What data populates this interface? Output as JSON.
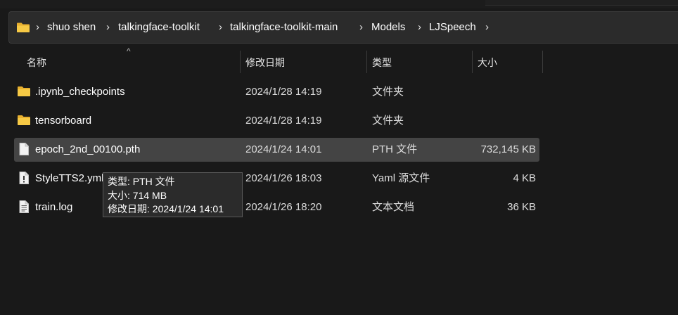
{
  "breadcrumb": {
    "items": [
      "shuo shen",
      "talkingface-toolkit",
      "talkingface-toolkit-main",
      "Models",
      "LJSpeech"
    ],
    "separator": "›"
  },
  "columns": {
    "name": "名称",
    "date": "修改日期",
    "type": "类型",
    "size": "大小",
    "sort_indicator": "^"
  },
  "files": [
    {
      "name": ".ipynb_checkpoints",
      "date": "2024/1/28 14:19",
      "type": "文件夹",
      "size": "",
      "icon": "folder-icon"
    },
    {
      "name": "tensorboard",
      "date": "2024/1/28 14:19",
      "type": "文件夹",
      "size": "",
      "icon": "folder-icon"
    },
    {
      "name": "epoch_2nd_00100.pth",
      "date": "2024/1/24 14:01",
      "type": "PTH 文件",
      "size": "732,145 KB",
      "icon": "file-icon",
      "selected": true
    },
    {
      "name": "StyleTTS2.yml",
      "date": "2024/1/26 18:03",
      "type": "Yaml 源文件",
      "size": "4 KB",
      "icon": "yaml-file-icon"
    },
    {
      "name": "train.log",
      "date": "2024/1/26 18:20",
      "type": "文本文档",
      "size": "36 KB",
      "icon": "text-file-icon"
    }
  ],
  "tooltip": {
    "type_line": "类型: PTH 文件",
    "size_line": "大小: 714 MB",
    "date_line": "修改日期: 2024/1/24 14:01"
  },
  "colors": {
    "background": "#191919",
    "selected_row": "#444444",
    "folder": "#f4c63d"
  }
}
